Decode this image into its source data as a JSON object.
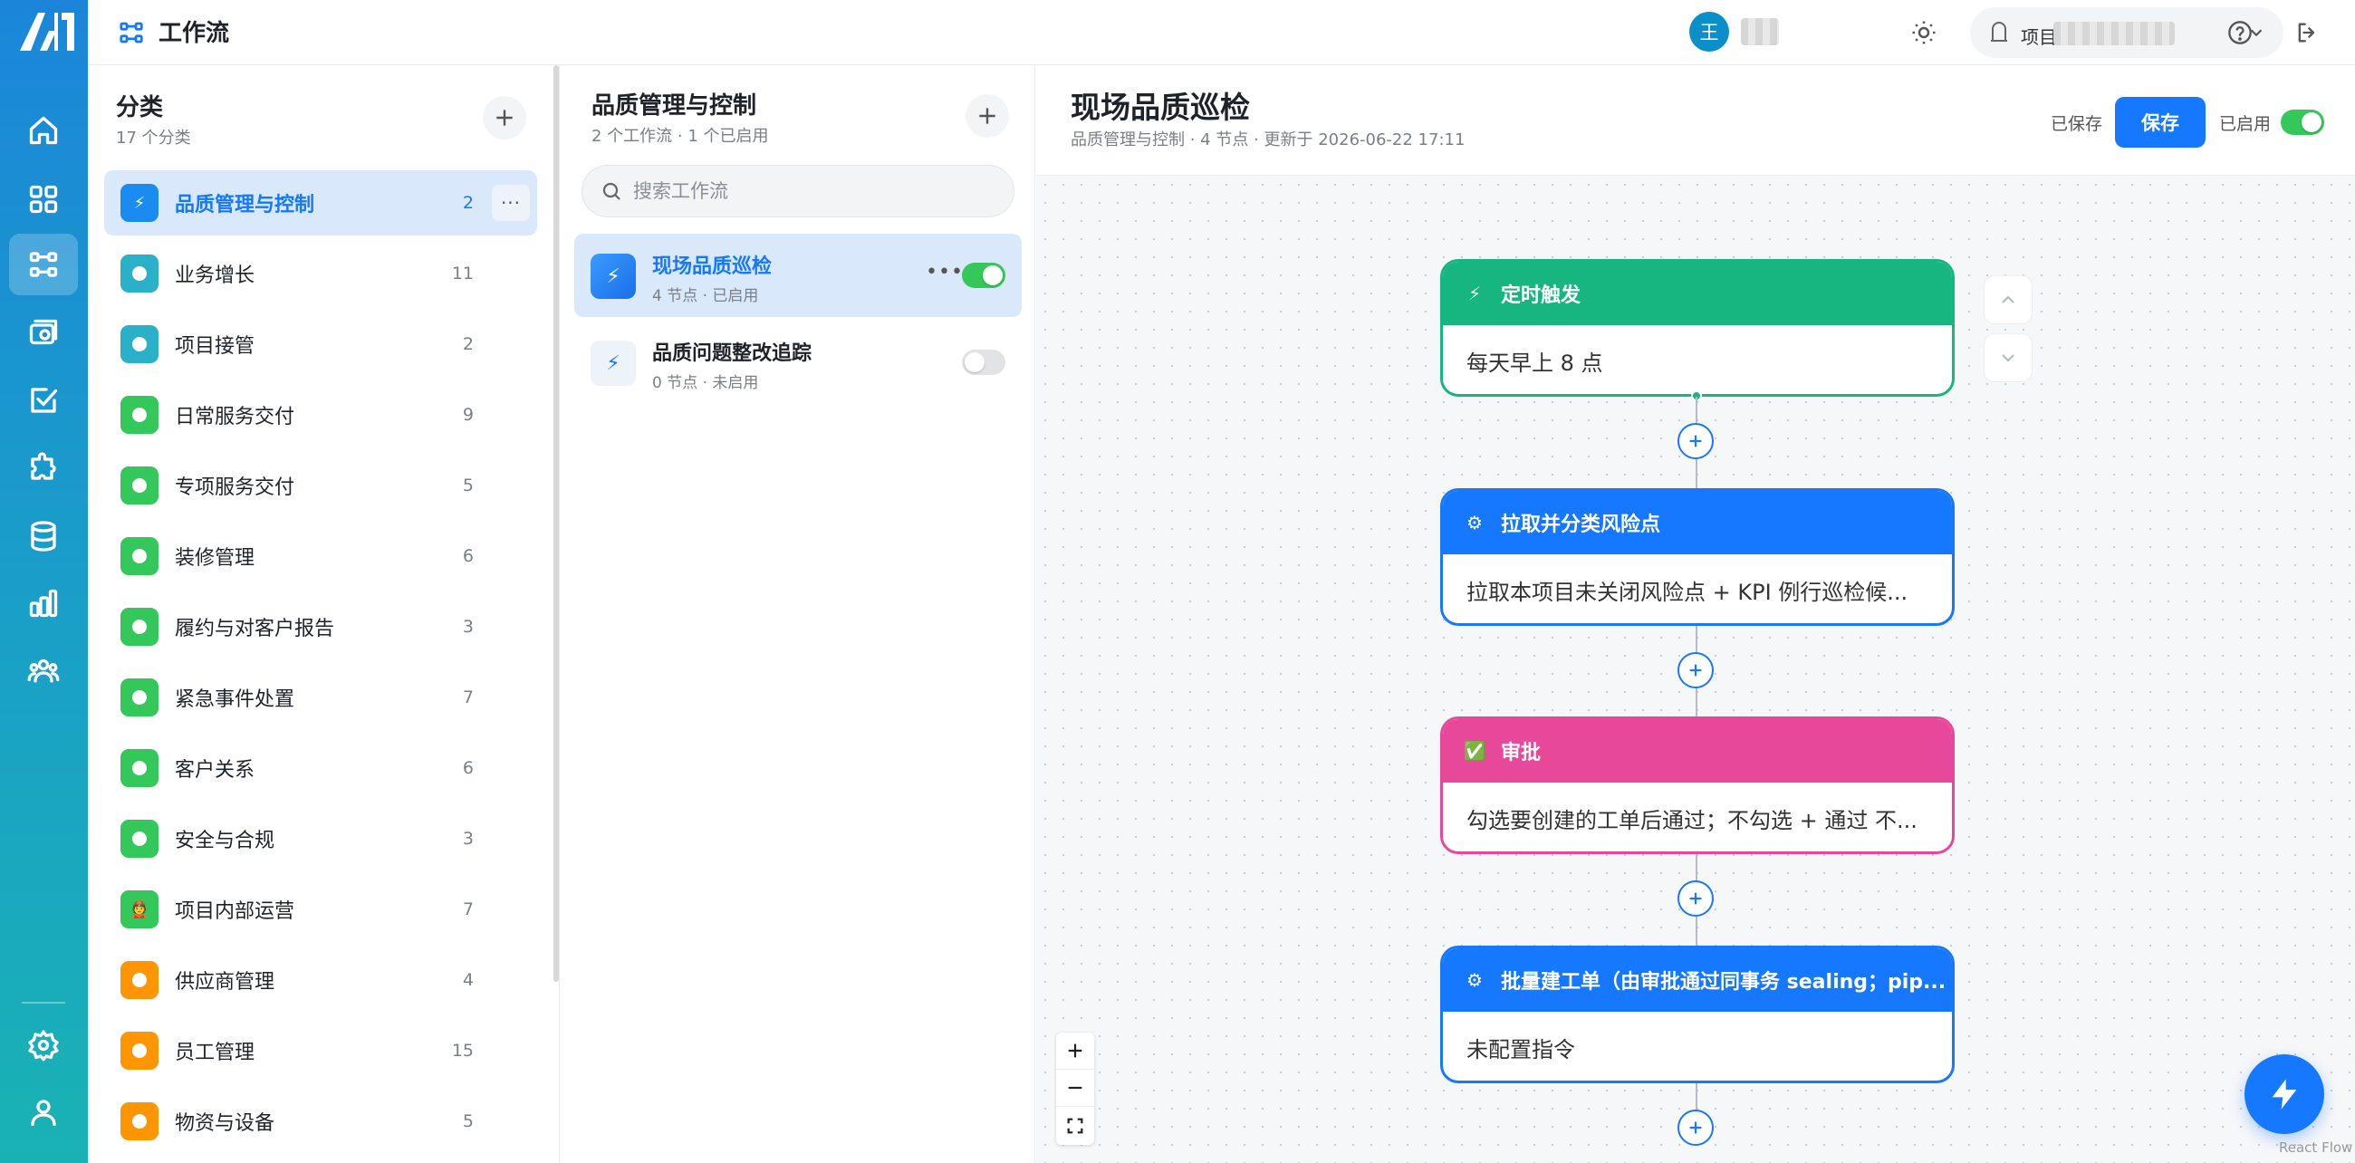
{
  "header": {
    "title": "工作流",
    "user_avatar_letter": "王",
    "project_label": "项目"
  },
  "categories": {
    "title": "分类",
    "subtitle": "17 个分类",
    "items": [
      {
        "name": "品质管理与控制",
        "count": "2",
        "color": "#1a8cf0",
        "icon": "bolt",
        "active": true
      },
      {
        "name": "业务增长",
        "count": "11",
        "color": "#2bb0c9",
        "icon": "dot"
      },
      {
        "name": "项目接管",
        "count": "2",
        "color": "#2bb0c9",
        "icon": "dot"
      },
      {
        "name": "日常服务交付",
        "count": "9",
        "color": "#34c759",
        "icon": "dot"
      },
      {
        "name": "专项服务交付",
        "count": "5",
        "color": "#34c759",
        "icon": "dot"
      },
      {
        "name": "装修管理",
        "count": "6",
        "color": "#34c759",
        "icon": "dot"
      },
      {
        "name": "履约与对客户报告",
        "count": "3",
        "color": "#34c759",
        "icon": "dot"
      },
      {
        "name": "紧急事件处置",
        "count": "7",
        "color": "#34c759",
        "icon": "dot"
      },
      {
        "name": "客户关系",
        "count": "6",
        "color": "#34c759",
        "icon": "dot"
      },
      {
        "name": "安全与合规",
        "count": "3",
        "color": "#34c759",
        "icon": "dot"
      },
      {
        "name": "项目内部运营",
        "count": "7",
        "color": "#34c759",
        "icon": "hat"
      },
      {
        "name": "供应商管理",
        "count": "4",
        "color": "#ff9500",
        "icon": "dot"
      },
      {
        "name": "员工管理",
        "count": "15",
        "color": "#ff9500",
        "icon": "dot"
      },
      {
        "name": "物资与设备",
        "count": "5",
        "color": "#ff9500",
        "icon": "dot"
      }
    ]
  },
  "workflows": {
    "title": "品质管理与控制",
    "subtitle": "2 个工作流 · 1 个已启用",
    "search_placeholder": "搜索工作流",
    "items": [
      {
        "name": "现场品质巡检",
        "meta": "4 节点 · 已启用",
        "enabled": true,
        "active": true
      },
      {
        "name": "品质问题整改追踪",
        "meta": "0 节点 · 未启用",
        "enabled": false,
        "active": false
      }
    ]
  },
  "editor": {
    "title": "现场品质巡检",
    "subtitle": "品质管理与控制 · 4 节点 · 更新于 2026-06-22 17:11",
    "saved_status": "已保存",
    "save_label": "保存",
    "enabled_label": "已启用",
    "enabled": true,
    "nodes": [
      {
        "type": "trigger",
        "title": "定时触发",
        "body": "每天早上 8 点",
        "color": "#17b57f",
        "icon": "⚡"
      },
      {
        "type": "action",
        "title": "拉取并分类风险点",
        "body": "拉取本项目未关闭风险点 + KPI 例行巡检候...",
        "color": "#1677ff",
        "icon": "⚙"
      },
      {
        "type": "approval",
        "title": "审批",
        "body": "勾选要创建的工单后通过；不勾选 + 通过 不...",
        "color": "#e8489a",
        "icon": "✅"
      },
      {
        "type": "action",
        "title": "批量建工单（由审批通过同事务 sealing；pip...",
        "body": "未配置指令",
        "color": "#1677ff",
        "icon": "⚙"
      }
    ],
    "attribution": "React Flow"
  }
}
